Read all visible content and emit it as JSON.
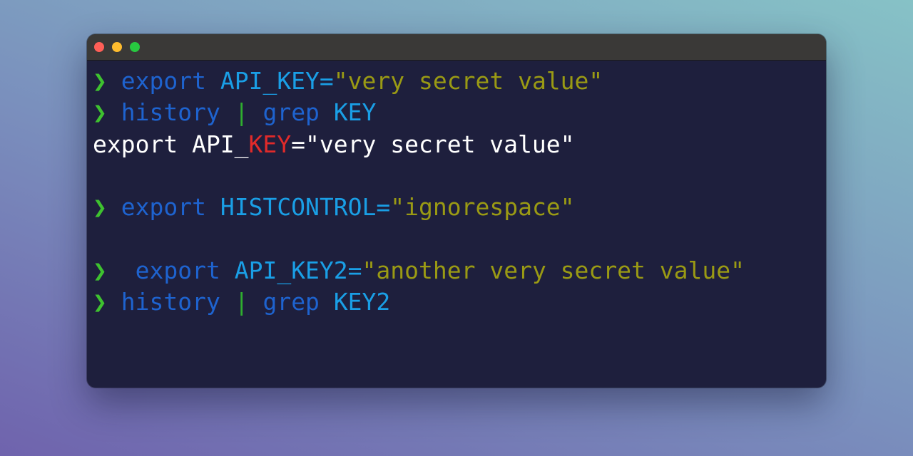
{
  "colors": {
    "background_gradient": [
      "#6f63ad",
      "#86c2c6"
    ],
    "window_bg": "#1e1f3d",
    "titlebar_bg": "#3a3937",
    "prompt": "#3ec22f",
    "command": "#1e63cf",
    "variable": "#1a9fe6",
    "string": "#9a9a14",
    "pipe": "#2fae2f",
    "output": "#ffffff",
    "match_highlight": "#e12a2a"
  },
  "window": {
    "controls": [
      "close-button",
      "minimize-button",
      "zoom-button"
    ]
  },
  "terminal": {
    "prompt_symbol": "❯",
    "lines": [
      {
        "cmd": "export",
        "var": "API_KEY=",
        "str": "\"very secret value\""
      },
      {
        "cmd": "history",
        "pipe": "|",
        "cmd2": "grep",
        "arg": "KEY"
      },
      {
        "before": "export API_",
        "match": "KEY",
        "after": "=\"very secret value\""
      },
      {
        "cmd": "export",
        "var": "HISTCONTROL=",
        "str": "\"ignorespace\""
      },
      {
        "cmd": "export",
        "var": "API_KEY2=",
        "str": "\"another very secret value\""
      },
      {
        "cmd": "history",
        "pipe": "|",
        "cmd2": "grep",
        "arg": "KEY2"
      }
    ]
  }
}
